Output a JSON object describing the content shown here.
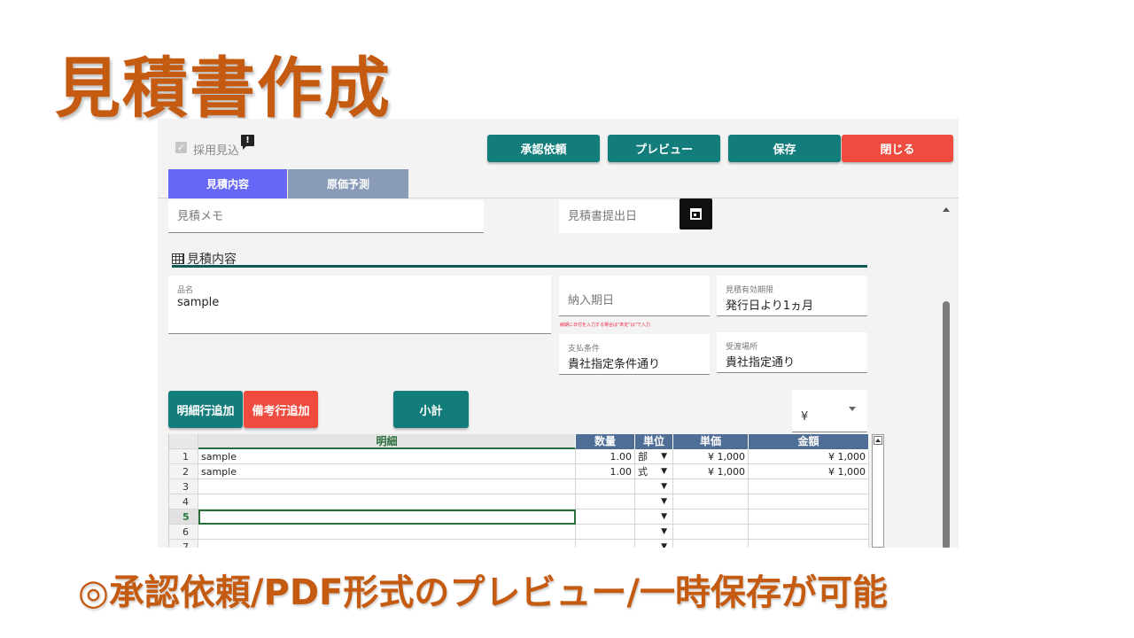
{
  "slide": {
    "title": "見積書作成",
    "caption": "◎承認依頼/PDF形式のプレビュー/一時保存が可能"
  },
  "header": {
    "checkbox_label": "採用見込",
    "checkbox_checked": true,
    "buttons": {
      "request_approval": "承認依頼",
      "preview": "プレビュー",
      "save": "保存",
      "close": "閉じる"
    },
    "tabs": [
      {
        "label": "見積内容",
        "active": true
      },
      {
        "label": "原価予測",
        "active": false
      }
    ]
  },
  "form": {
    "memo_placeholder": "見積メモ",
    "submit_date_placeholder": "見積書提出日",
    "section_title": "見積内容",
    "item_name": {
      "label": "品名",
      "value": "sample"
    },
    "delivery_date_placeholder": "納入期日",
    "delivery_hint": "納期に日付を入力する場合は\"未定\"は\"で入力",
    "validity": {
      "label": "見積有効期限",
      "value": "発行日より1ヵ月"
    },
    "payment": {
      "label": "支払条件",
      "value": "貴社指定条件通り"
    },
    "delivery_place": {
      "label": "受渡場所",
      "value": "貴社指定通り"
    }
  },
  "actions": {
    "add_detail_row": "明細行追加",
    "add_note_row": "備考行追加",
    "subtotal": "小計",
    "currency_symbol": "¥"
  },
  "table": {
    "columns": [
      "明細",
      "数量",
      "単位",
      "単価",
      "金額"
    ],
    "rows": [
      {
        "no": "1",
        "detail": "sample",
        "qty": "1.00",
        "unit": "部",
        "price": "¥ 1,000",
        "amount": "¥ 1,000"
      },
      {
        "no": "2",
        "detail": "sample",
        "qty": "1.00",
        "unit": "式",
        "price": "¥ 1,000",
        "amount": "¥ 1,000"
      },
      {
        "no": "3",
        "detail": "",
        "qty": "",
        "unit": "",
        "price": "",
        "amount": ""
      },
      {
        "no": "4",
        "detail": "",
        "qty": "",
        "unit": "",
        "price": "",
        "amount": ""
      },
      {
        "no": "5",
        "detail": "",
        "qty": "",
        "unit": "",
        "price": "",
        "amount": ""
      },
      {
        "no": "6",
        "detail": "",
        "qty": "",
        "unit": "",
        "price": "",
        "amount": ""
      },
      {
        "no": "7",
        "detail": "",
        "qty": "",
        "unit": "",
        "price": "",
        "amount": ""
      }
    ],
    "selected_row": 5
  },
  "colors": {
    "accent_orange": "#c55a11",
    "teal": "#127d7a",
    "red": "#ef4b3f",
    "tab_active": "#6667f6",
    "tab_inactive": "#8a9bb7",
    "header_blue": "#4f6e96"
  }
}
